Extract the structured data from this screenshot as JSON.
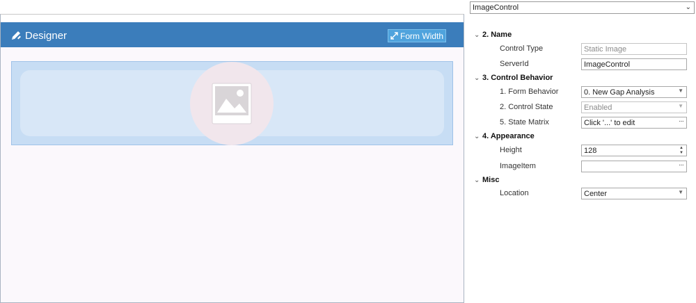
{
  "designer": {
    "title": "Designer",
    "form_width_label": "Form Width",
    "image_control_icon": "image-placeholder-icon",
    "header_color": "#3b7dbb"
  },
  "properties": {
    "object_selector": "ImageControl",
    "categories": {
      "name": {
        "label": "2. Name"
      },
      "behavior": {
        "label": "3. Control Behavior"
      },
      "appearance": {
        "label": "4. Appearance"
      },
      "misc": {
        "label": "Misc"
      }
    },
    "rows": {
      "control_type": {
        "label": "Control Type",
        "value": "Static Image"
      },
      "server_id": {
        "label": "ServerId",
        "value": "ImageControl"
      },
      "form_behavior": {
        "label": "1. Form Behavior",
        "value": "0. New Gap Analysis"
      },
      "control_state": {
        "label": "2. Control State",
        "value": "Enabled"
      },
      "state_matrix": {
        "label": "5. State Matrix",
        "value": "Click '...' to edit"
      },
      "height": {
        "label": "Height",
        "value": "128"
      },
      "image_item": {
        "label": "ImageItem",
        "value": ""
      },
      "location": {
        "label": "Location",
        "value": "Center"
      }
    }
  }
}
